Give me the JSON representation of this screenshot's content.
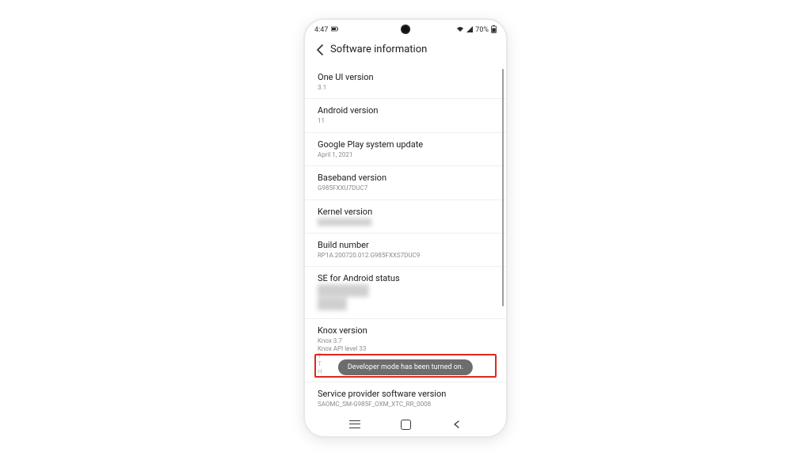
{
  "status": {
    "time": "4:47",
    "battery_pct": "70%"
  },
  "appbar": {
    "title": "Software information"
  },
  "items": {
    "one_ui": {
      "title": "One UI version",
      "sub": "3.1"
    },
    "android": {
      "title": "Android version",
      "sub": "11"
    },
    "play_update": {
      "title": "Google Play system update",
      "sub": "April 1, 2021"
    },
    "baseband": {
      "title": "Baseband version",
      "sub": "G985FXXU7DUC7"
    },
    "kernel": {
      "title": "Kernel version"
    },
    "build": {
      "title": "Build number",
      "sub": "RP1A.200720.012.G985FXXS7DUC9"
    },
    "se_android": {
      "title": "SE for Android status"
    },
    "knox": {
      "title": "Knox version",
      "sub1": "Knox 3.7",
      "sub2": "Knox API level 33"
    },
    "sp_sw": {
      "title": "Service provider software version",
      "sub": "SAOMC_SM-G985F_OXM_XTC_RR_0008"
    }
  },
  "toast": {
    "text": "Developer mode has been turned on."
  }
}
